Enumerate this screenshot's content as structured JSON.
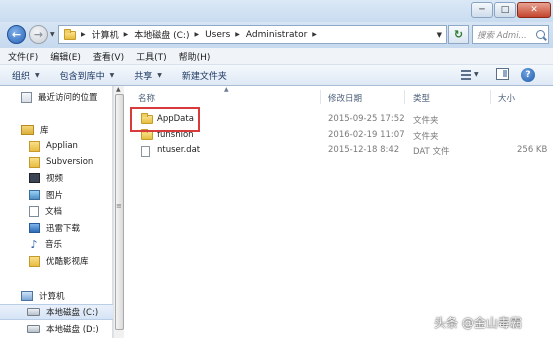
{
  "window": {
    "controls": {
      "minimize": "─",
      "maximize": "□",
      "close": "✕"
    }
  },
  "address": {
    "back": "←",
    "forward": "→",
    "crumbs": [
      "计算机",
      "本地磁盘 (C:)",
      "Users",
      "Administrator"
    ],
    "search_placeholder": "搜索 Admi..."
  },
  "menu": [
    "文件(F)",
    "编辑(E)",
    "查看(V)",
    "工具(T)",
    "帮助(H)"
  ],
  "commands": [
    {
      "label": "组织",
      "dropdown": true
    },
    {
      "label": "包含到库中",
      "dropdown": true
    },
    {
      "label": "共享",
      "dropdown": true
    },
    {
      "label": "新建文件夹",
      "dropdown": false
    }
  ],
  "nav": {
    "recent": "最近访问的位置",
    "libraries": "库",
    "lib_items": [
      {
        "label": "Applian",
        "icon": "folder-icon"
      },
      {
        "label": "Subversion",
        "icon": "subversion-icon"
      },
      {
        "label": "视频",
        "icon": "video-icon"
      },
      {
        "label": "图片",
        "icon": "picture-icon"
      },
      {
        "label": "文档",
        "icon": "document-icon"
      },
      {
        "label": "迅雷下载",
        "icon": "download-icon"
      },
      {
        "label": "音乐",
        "icon": "music-icon"
      },
      {
        "label": "优酷影视库",
        "icon": "folder-icon"
      }
    ],
    "computer": "计算机",
    "drives": [
      {
        "label": "本地磁盘 (C:)",
        "selected": true
      },
      {
        "label": "本地磁盘 (D:)",
        "selected": false
      }
    ]
  },
  "columns": {
    "name": "名称",
    "modified": "修改日期",
    "type": "类型",
    "size": "大小"
  },
  "files": [
    {
      "name": "AppData",
      "modified": "2015-09-25 17:52",
      "type": "文件夹",
      "size": "",
      "kind": "folder"
    },
    {
      "name": "funshion",
      "modified": "2016-02-19 11:07",
      "type": "文件夹",
      "size": "",
      "kind": "folder"
    },
    {
      "name": "ntuser.dat",
      "modified": "2015-12-18 8:42",
      "type": "DAT 文件",
      "size": "256 KB",
      "kind": "file"
    }
  ],
  "watermark": "头条 @金山毒霸",
  "colors": {
    "highlight": "#d83b3b",
    "accent": "#2a62b5"
  }
}
